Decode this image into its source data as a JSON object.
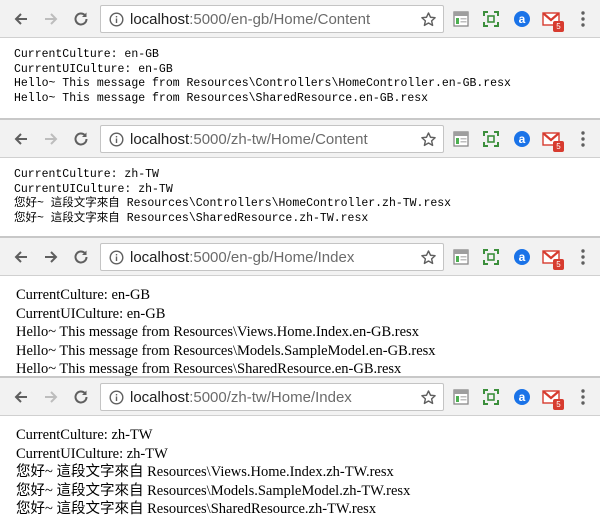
{
  "windows": [
    {
      "url": {
        "host": "localhost",
        "rest": ":5000/en-gb/Home/Content"
      },
      "lines": [
        "CurrentCulture: en-GB",
        "CurrentUICulture: en-GB",
        "Hello~ This message from Resources\\Controllers\\HomeController.en-GB.resx",
        "Hello~ This message from Resources\\SharedResource.en-GB.resx"
      ]
    },
    {
      "url": {
        "host": "localhost",
        "rest": ":5000/zh-tw/Home/Content"
      },
      "lines": [
        "CurrentCulture: zh-TW",
        "CurrentUICulture: zh-TW",
        "您好~ 這段文字來自 Resources\\Controllers\\HomeController.zh-TW.resx",
        "您好~ 這段文字來自 Resources\\SharedResource.zh-TW.resx"
      ]
    },
    {
      "url": {
        "host": "localhost",
        "rest": ":5000/en-gb/Home/Index"
      },
      "lines": [
        "CurrentCulture: en-GB",
        "CurrentUICulture: en-GB",
        "Hello~ This message from Resources\\Views.Home.Index.en-GB.resx",
        "Hello~ This message from Resources\\Models.SampleModel.en-GB.resx",
        "Hello~ This message from Resources\\SharedResource.en-GB.resx"
      ]
    },
    {
      "url": {
        "host": "localhost",
        "rest": ":5000/zh-tw/Home/Index"
      },
      "lines": [
        "CurrentCulture: zh-TW",
        "CurrentUICulture: zh-TW",
        "您好~ 這段文字來自 Resources\\Views.Home.Index.zh-TW.resx",
        "您好~ 這段文字來自 Resources\\Models.SampleModel.zh-TW.resx",
        "您好~ 這段文字來自 Resources\\SharedResource.zh-TW.resx"
      ]
    }
  ],
  "toolbar": {
    "icons": {
      "back": "arrow-left-icon",
      "forward": "arrow-right-icon",
      "reload": "reload-icon",
      "info": "info-icon",
      "bookmark": "star-icon",
      "extensions": [
        "page-extension-icon",
        "screenshot-extension-icon",
        "at-sign-extension-icon",
        "gmail-extension-icon"
      ],
      "menu": "kebab-menu-icon"
    },
    "gmail_badge": "5"
  },
  "colors": {
    "toolbar_bg": "#f2f2f2",
    "omnibox_border": "#c4c4c4",
    "gmail_red": "#d73b2f",
    "at_sign_blue": "#1a73e8"
  }
}
